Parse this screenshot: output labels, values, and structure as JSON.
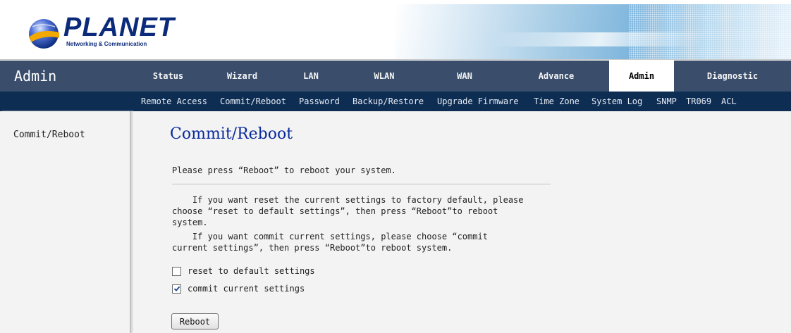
{
  "brand": {
    "logo_text": "PLANET",
    "logo_subtitle": "Networking & Communication"
  },
  "topnav": {
    "section_title": "Admin",
    "tabs": [
      {
        "label": "Status",
        "active": false
      },
      {
        "label": "Wizard",
        "active": false
      },
      {
        "label": "LAN",
        "active": false
      },
      {
        "label": "WLAN",
        "active": false
      },
      {
        "label": "WAN",
        "active": false
      },
      {
        "label": "Advance",
        "active": false
      },
      {
        "label": "Admin",
        "active": true
      },
      {
        "label": "Diagnostic",
        "active": false
      }
    ]
  },
  "subnav": {
    "items": [
      "Remote Access",
      "Commit/Reboot",
      "Password",
      "Backup/Restore",
      "Upgrade Firmware",
      "Time Zone",
      "System Log",
      "SNMP",
      "TR069",
      "ACL"
    ]
  },
  "sidebar": {
    "items": [
      "Commit/Reboot"
    ]
  },
  "main": {
    "title": "Commit/Reboot",
    "intro": "Please press “Reboot” to reboot your system.",
    "help_lines": [
      "    If you want reset the current settings to factory default, please",
      "choose “reset to default settings”, then press “Reboot”to reboot",
      "system.",
      "    If you want commit current settings, please choose “commit",
      "current settings”, then press “Reboot”to reboot system."
    ],
    "options": [
      {
        "label": "reset to default settings",
        "checked": false
      },
      {
        "label": "commit current settings",
        "checked": true
      }
    ],
    "reboot_button": "Reboot"
  },
  "colors": {
    "topnav_bg": "#3a4e6c",
    "subnav_bg": "#0d2d53",
    "title_blue": "#0a2a9c",
    "content_bg": "#f3f3f3",
    "logo_blue": "#0b2b7a"
  }
}
